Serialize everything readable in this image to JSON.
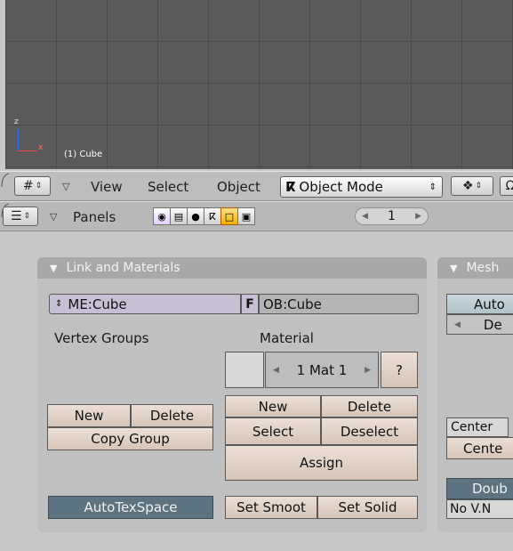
{
  "viewport": {
    "axis_z": "z",
    "axis_x": "x",
    "object_label": "(1) Cube"
  },
  "header1": {
    "menu": [
      "View",
      "Select",
      "Object"
    ],
    "mode": "Object Mode"
  },
  "header2": {
    "panels_label": "Panels",
    "page_number": "1"
  },
  "link_materials": {
    "title": "Link and Materials",
    "mesh_name": "ME:Cube",
    "fake_user": "F",
    "object_name": "OB:Cube",
    "vertex_groups_label": "Vertex Groups",
    "material_label": "Material",
    "material_value": "1 Mat 1",
    "material_help": "?",
    "vg_new": "New",
    "vg_delete": "Delete",
    "copy_group": "Copy Group",
    "mat_new": "New",
    "mat_delete": "Delete",
    "mat_select": "Select",
    "mat_deselect": "Deselect",
    "assign": "Assign",
    "autotexspace": "AutoTexSpace",
    "set_smooth": "Set Smoot",
    "set_solid": "Set Solid"
  },
  "mesh_panel": {
    "title": "Mesh",
    "auto": "Auto",
    "de": "De",
    "center": "Center",
    "center2": "Cente",
    "double": "Doub",
    "no_vn": "No V.N"
  }
}
